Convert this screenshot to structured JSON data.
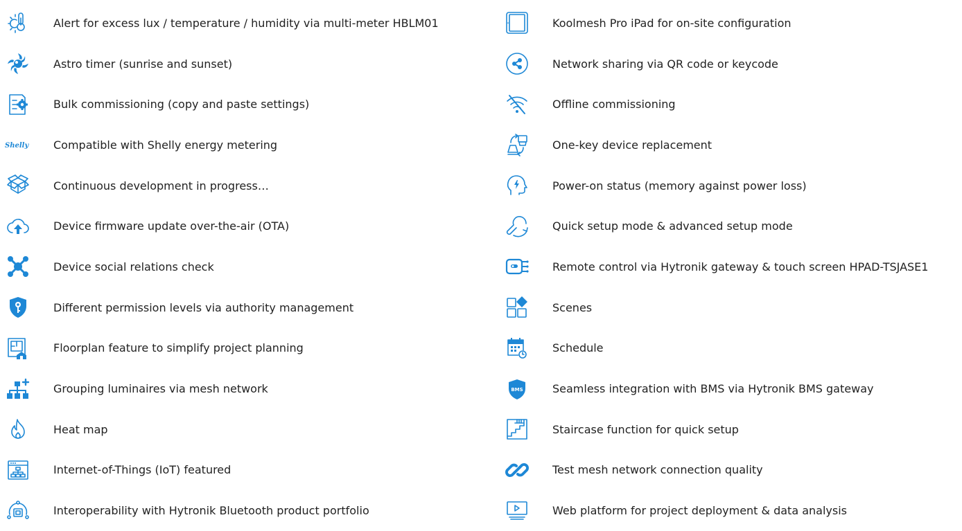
{
  "features": {
    "left": [
      {
        "icon": "thermometer-sun-icon",
        "label": "Alert for excess lux / temperature / humidity via multi-meter HBLM01"
      },
      {
        "icon": "astro-timer-icon",
        "label": "Astro timer (sunrise and sunset)"
      },
      {
        "icon": "bulk-settings-icon",
        "label": "Bulk commissioning (copy and paste settings)"
      },
      {
        "icon": "shelly-logo-icon",
        "label": "Compatible with Shelly energy metering",
        "logo_text": "Shelly"
      },
      {
        "icon": "open-box-icon",
        "label": "Continuous development in progress…"
      },
      {
        "icon": "cloud-upload-icon",
        "label": "Device firmware update over-the-air (OTA)"
      },
      {
        "icon": "social-network-icon",
        "label": "Device social relations check"
      },
      {
        "icon": "shield-key-icon",
        "label": "Different permission levels via authority management"
      },
      {
        "icon": "floorplan-icon",
        "label": "Floorplan feature to simplify project planning"
      },
      {
        "icon": "group-network-icon",
        "label": "Grouping luminaires via mesh network"
      },
      {
        "icon": "flame-icon",
        "label": "Heat map"
      },
      {
        "icon": "iot-browser-icon",
        "label": "Internet-of-Things (IoT) featured"
      },
      {
        "icon": "interoperability-icon",
        "label": "Interoperability with Hytronik Bluetooth product portfolio"
      }
    ],
    "right": [
      {
        "icon": "tablet-icon",
        "label": "Koolmesh Pro iPad for on-site configuration"
      },
      {
        "icon": "share-icon",
        "label": "Network sharing via QR code or keycode"
      },
      {
        "icon": "wifi-off-icon",
        "label": "Offline commissioning"
      },
      {
        "icon": "device-replace-icon",
        "label": "One-key device replacement"
      },
      {
        "icon": "power-memory-icon",
        "label": "Power-on status (memory against power loss)"
      },
      {
        "icon": "setup-mode-icon",
        "label": "Quick setup mode & advanced setup mode"
      },
      {
        "icon": "remote-control-icon",
        "label": "Remote control via Hytronik gateway & touch screen HPAD-TSJASE1"
      },
      {
        "icon": "scenes-icon",
        "label": "Scenes"
      },
      {
        "icon": "calendar-icon",
        "label": "Schedule"
      },
      {
        "icon": "bms-shield-icon",
        "label": "Seamless integration with BMS via Hytronik BMS gateway",
        "logo_text": "BMS"
      },
      {
        "icon": "staircase-icon",
        "label": "Staircase function for quick setup"
      },
      {
        "icon": "link-icon",
        "label": "Test mesh network connection quality"
      },
      {
        "icon": "monitor-play-icon",
        "label": "Web platform for project deployment & data analysis"
      }
    ]
  },
  "colors": {
    "accent": "#1e88d6",
    "text": "#222222",
    "background": "#ffffff"
  }
}
